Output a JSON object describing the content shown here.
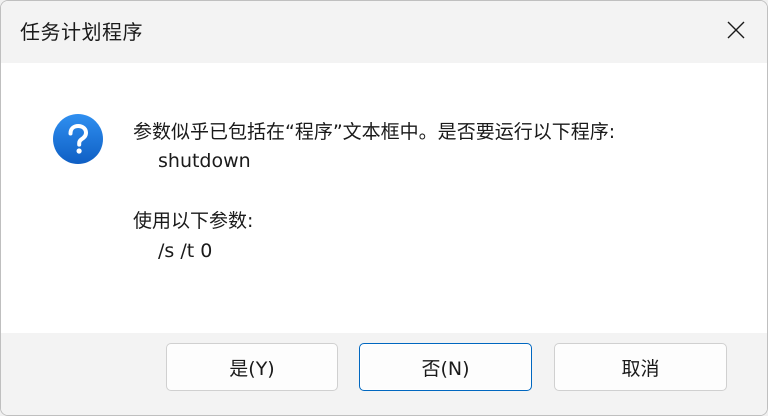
{
  "window": {
    "title": "任务计划程序"
  },
  "dialog": {
    "message_line1": "参数似乎已包括在“程序”文本框中。是否要运行以下程序:",
    "program": "shutdown",
    "message_line3": "使用以下参数:",
    "arguments": "/s /t 0",
    "icon": "question-icon"
  },
  "buttons": {
    "yes_label": "是(Y)",
    "no_label": "否(N)",
    "cancel_label": "取消"
  },
  "colors": {
    "icon_blue": "#1a73d9",
    "focus_border": "#0067c0"
  }
}
